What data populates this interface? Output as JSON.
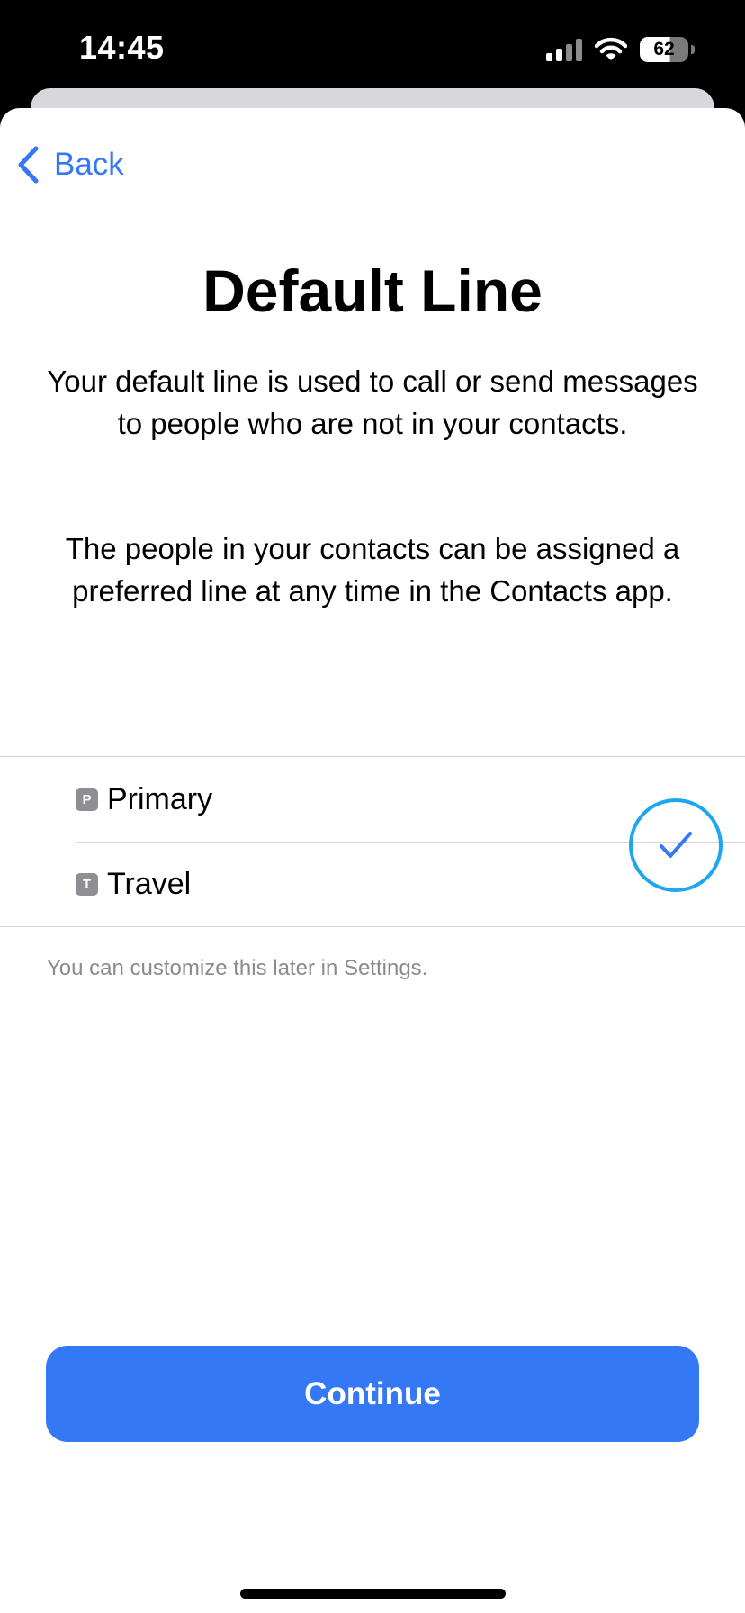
{
  "status_bar": {
    "time": "14:45",
    "battery_level": "62",
    "battery_fraction": 0.62,
    "signal_icon": "cellular-signal-icon",
    "wifi_icon": "wifi-icon"
  },
  "nav": {
    "back_label": "Back",
    "back_icon": "chevron-left-icon"
  },
  "page": {
    "title": "Default Line",
    "description_1": "Your default line is used to call or send messages to people who are not in your contacts.",
    "description_2": "The people in your contacts can be assigned a preferred line at any time in the Contacts app."
  },
  "lines": {
    "items": [
      {
        "badge": "P",
        "label": "Primary",
        "selected": true
      },
      {
        "badge": "T",
        "label": "Travel",
        "selected": false
      }
    ],
    "check_icon": "checkmark-icon"
  },
  "footnote": "You can customize this later in Settings.",
  "continue_label": "Continue",
  "colors": {
    "accent": "#3478f6",
    "highlight_ring": "#1ea7f0",
    "badge_gray": "#8e8e93",
    "secondary_text": "#8a8a8e"
  }
}
